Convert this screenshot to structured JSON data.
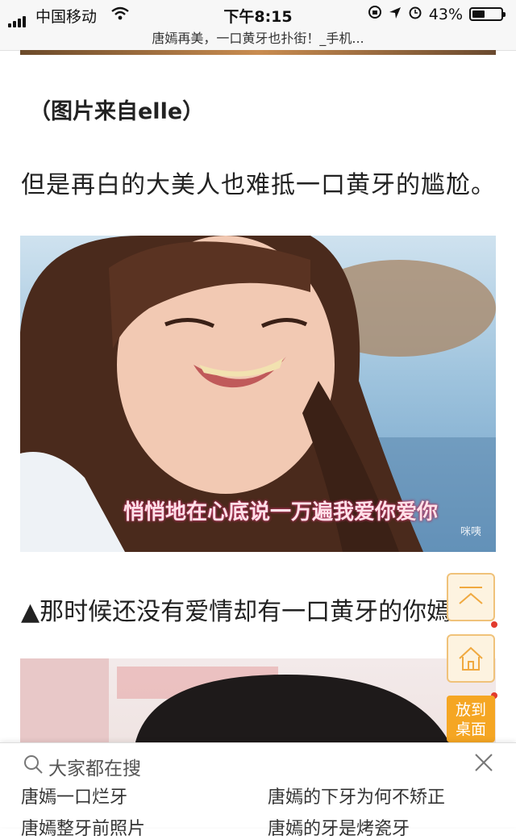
{
  "status_bar": {
    "carrier": "中国移动",
    "time": "下午8:15",
    "battery_text": "43%",
    "battery_level": 0.43
  },
  "browser": {
    "page_title": "唐嫣再美，一口黄牙也扑街！_手机..."
  },
  "article": {
    "image_credit": "（图片来自elle）",
    "paragraph": "但是再白的大美人也难抵一口黄牙的尴尬。",
    "photo1_subtitle": "悄悄地在心底说一万遍我爱你爱你",
    "photo1_watermark": "咪咦",
    "caption": "▲那时候还没有爱情却有一口黄牙的你嫣"
  },
  "floating": {
    "desktop_label_line1": "放到",
    "desktop_label_line2": "桌面"
  },
  "search_panel": {
    "title": "大家都在搜",
    "items": [
      "唐嫣一口烂牙",
      "唐嫣的下牙为何不矫正",
      "唐嫣整牙前照片",
      "唐嫣的牙是烤瓷牙"
    ]
  },
  "colors": {
    "accent_orange": "#f5a623",
    "button_border": "#f0c27a",
    "notification_red": "#e23b2e"
  }
}
